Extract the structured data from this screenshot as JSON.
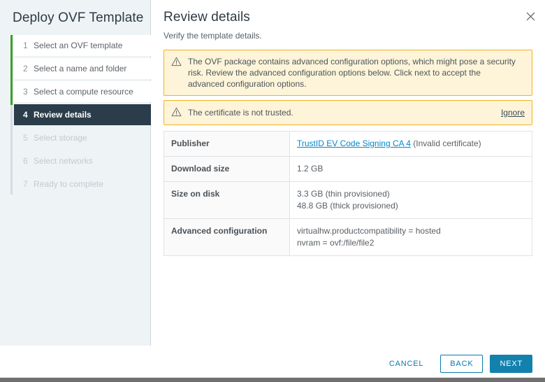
{
  "window": {
    "title": "Deploy OVF Template",
    "close_icon": "close-icon"
  },
  "sidebar": {
    "progress_color": "#3aa028",
    "active_bg": "#2b3d4a",
    "steps": [
      {
        "num": "1",
        "label": "Select an OVF template",
        "state": "completed"
      },
      {
        "num": "2",
        "label": "Select a name and folder",
        "state": "completed"
      },
      {
        "num": "3",
        "label": "Select a compute resource",
        "state": "completed"
      },
      {
        "num": "4",
        "label": "Review details",
        "state": "active"
      },
      {
        "num": "5",
        "label": "Select storage",
        "state": "disabled"
      },
      {
        "num": "6",
        "label": "Select networks",
        "state": "disabled"
      },
      {
        "num": "7",
        "label": "Ready to complete",
        "state": "disabled"
      }
    ]
  },
  "content": {
    "title": "Review details",
    "subtitle": "Verify the template details.",
    "alerts": [
      {
        "icon": "warning-triangle-icon",
        "text": "The OVF package contains advanced configuration options, which might pose a security risk. Review the advanced configuration options below. Click next to accept the advanced configuration options.",
        "action": "",
        "border_color": "#efb41e",
        "background_color": "#fdf4d9"
      },
      {
        "icon": "warning-triangle-icon",
        "text": "The certificate is not trusted.",
        "action": "Ignore",
        "border_color": "#efb41e",
        "background_color": "#fdf4d9"
      }
    ],
    "details": [
      {
        "key": "Publisher",
        "link": "TrustID EV Code Signing CA 4",
        "link_color": "#0088cc",
        "suffix": " (Invalid certificate)",
        "values": []
      },
      {
        "key": "Download size",
        "link": "",
        "suffix": "",
        "values": [
          "1.2 GB"
        ]
      },
      {
        "key": "Size on disk",
        "link": "",
        "suffix": "",
        "values": [
          "3.3 GB (thin provisioned)",
          "48.8 GB (thick provisioned)"
        ]
      },
      {
        "key": "Advanced configuration",
        "link": "",
        "suffix": "",
        "values": [
          "virtualhw.productcompatibility = hosted",
          "nvram = ovf:/file/file2"
        ]
      }
    ]
  },
  "footer": {
    "cancel_label": "CANCEL",
    "back_label": "BACK",
    "next_label": "NEXT",
    "primary_color": "#1381ae",
    "link_color": "#0a7aab"
  }
}
